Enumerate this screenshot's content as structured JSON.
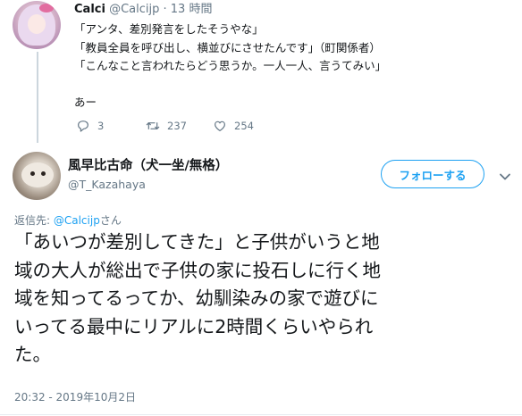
{
  "parent_tweet": {
    "display_name": "Calci",
    "handle": "@Calcijp",
    "separator": "·",
    "time": "13 時間",
    "lines": [
      "「アンタ、差別発言をしたそうやな」",
      "「教員全員を呼び出し、横並びにさせたんです」（町関係者）",
      "「こんなこと言われたらどう思うか。一人一人、言うてみい」",
      "あー"
    ],
    "replies": "3",
    "retweets": "237",
    "likes": "254"
  },
  "main_tweet": {
    "display_name": "風早比古命（犬一坐/無格）",
    "handle": "@T_Kazahaya",
    "follow_label": "フォローする",
    "reply_prefix": "返信先: ",
    "reply_mention": "@Calcijp",
    "reply_suffix": "さん",
    "body_lines": [
      "「あいつが差別してきた」と子供がいうと地",
      "域の大人が総出で子供の家に投石しに行く地",
      "域を知ってるってか、幼馴染みの家で遊びに",
      "いってる最中にリアルに2時間くらいやられ",
      "た。"
    ],
    "timestamp": "20:32 - 2019年10月2日"
  },
  "colors": {
    "accent": "#1da1f2",
    "muted": "#657786",
    "text": "#14171a",
    "divider": "#e6ecf0"
  },
  "icons": {
    "reply": "reply-icon",
    "retweet": "retweet-icon",
    "like": "heart-icon",
    "menu": "chevron-down-icon"
  }
}
